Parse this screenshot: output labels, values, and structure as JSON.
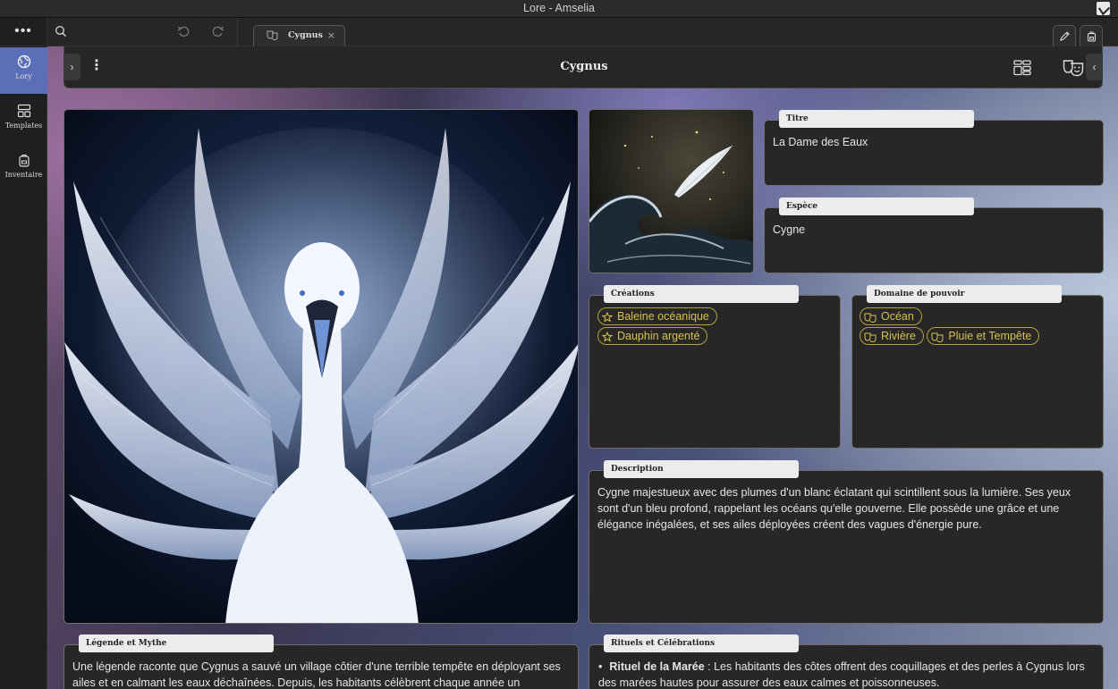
{
  "window": {
    "title": "Lore - Amselia"
  },
  "rail": {
    "menu_glyph": "•••",
    "items": [
      {
        "label": "Lory",
        "icon": "globe-icon",
        "active": true
      },
      {
        "label": "Templates",
        "icon": "layout-grid-icon",
        "active": false
      },
      {
        "label": "Inventaire",
        "icon": "backpack-icon",
        "active": false
      }
    ]
  },
  "toolbar": {
    "tab": {
      "label": "Cygnus",
      "icon": "masks-icon",
      "close_glyph": "×"
    },
    "right_buttons": [
      "pen-icon",
      "backpack-icon"
    ]
  },
  "view": {
    "title": "Cygnus",
    "expand_glyph": "›",
    "collapse_glyph": "‹",
    "more_glyph": "⋮"
  },
  "fields": {
    "titre": {
      "label": "Titre",
      "value": "La Dame des Eaux"
    },
    "espece": {
      "label": "Espèce",
      "value": "Cygne"
    },
    "creations": {
      "label": "Créations",
      "tags": [
        "Baleine océanique",
        "Dauphin argenté"
      ]
    },
    "domaine": {
      "label": "Domaine de pouvoir",
      "tags": [
        "Océan",
        "Rivière",
        "Pluie et Tempête"
      ]
    },
    "description": {
      "label": "Description",
      "value": "Cygne majestueux avec des plumes d'un blanc éclatant qui scintillent sous la lumière. Ses yeux sont d'un bleu profond, rappelant les océans qu'elle gouverne. Elle possède une grâce et une élégance inégalées, et ses ailes déployées créent des vagues d'énergie pure."
    },
    "legende": {
      "label": "Légende et Mythe",
      "value": "Une légende raconte que Cygnus a sauvé un village côtier d'une terrible tempête en déployant ses ailes et en calmant les eaux déchaînées. Depuis, les habitants célèbrent chaque année un"
    },
    "rituels": {
      "label": "Rituels et Célébrations",
      "items": [
        {
          "title": "Rituel de la Marée",
          "text": " : Les habitants des côtes offrent des coquillages et des perles à Cygnus lors des marées hautes pour assurer des eaux calmes et poissonneuses."
        }
      ]
    }
  },
  "colors": {
    "accent_tag": "#d9c14a",
    "rail_active": "#5b6fb8"
  }
}
